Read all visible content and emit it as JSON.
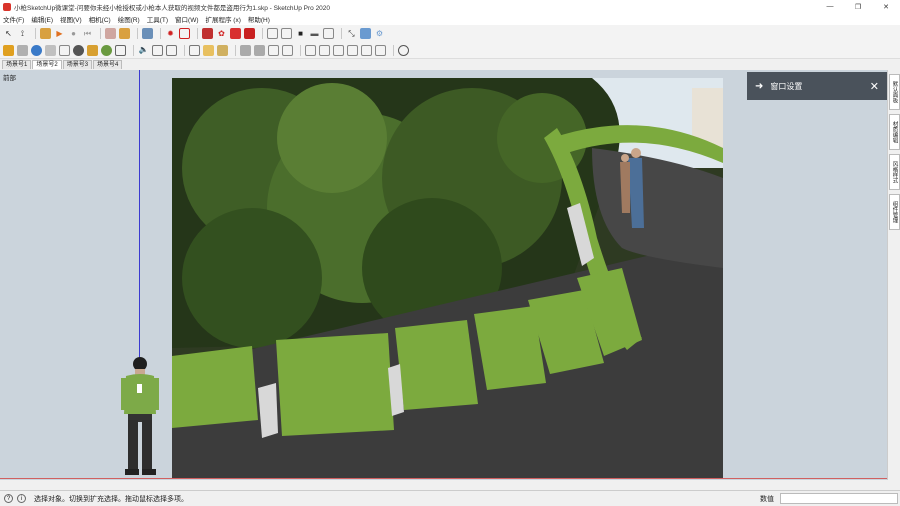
{
  "window": {
    "title": "小枪SketchUp微课堂-问要你未经小枪授权或小枪本人获取的视频文件都是盗用行为1.skp - SketchUp Pro 2020",
    "minimize": "—",
    "maximize": "❐",
    "close": "✕"
  },
  "menu": [
    "文件(F)",
    "编辑(E)",
    "视图(V)",
    "相机(C)",
    "绘图(R)",
    "工具(T)",
    "窗口(W)",
    "扩展程序 (x)",
    "帮助(H)"
  ],
  "scenes": [
    "场景号1",
    "场景号2",
    "场景号3",
    "场景号4"
  ],
  "active_scene": "场景号2",
  "view_label": "前部",
  "tray": {
    "title": "窗口设置",
    "arrow": "➜",
    "close": "✕"
  },
  "side_tabs": [
    "默认面板",
    "材质编辑",
    "风格样式",
    "组件管理"
  ],
  "status": {
    "text": "选择对象。切换到扩充选择。拖动鼠标选择多项。",
    "measure_label": "数值",
    "measure_value": ""
  },
  "colors": {
    "tray_bg": "#4a525b",
    "viewport_bg": "#cbd4dc",
    "axis_blue": "#3a3ad0",
    "axis_red": "#d06060",
    "bench_green": "#7caa3e"
  }
}
